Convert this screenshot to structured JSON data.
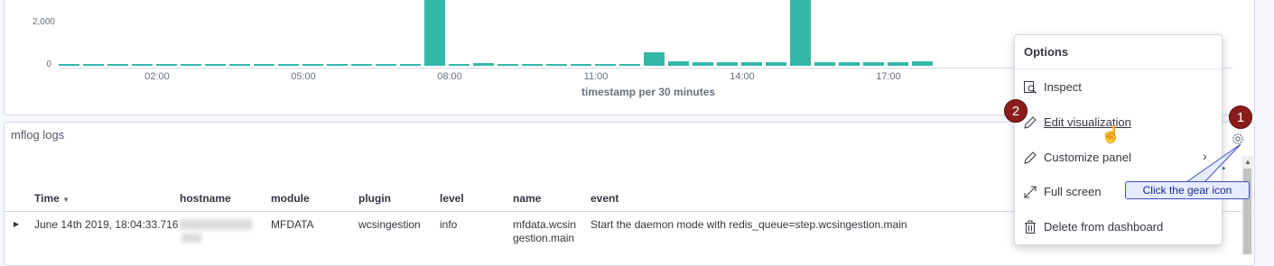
{
  "chart": {
    "y_ticks": [
      "2,000",
      "0"
    ],
    "x_ticks": [
      "02:00",
      "05:00",
      "08:00",
      "11:00",
      "14:00",
      "17:00"
    ],
    "x_title": "timestamp per 30 minutes",
    "bar_color": "#35b8a8"
  },
  "chart_data": {
    "type": "bar",
    "title": "",
    "xlabel": "timestamp per 30 minutes",
    "ylabel": "",
    "x": [
      "00:30",
      "01:00",
      "01:30",
      "02:00",
      "02:30",
      "03:00",
      "03:30",
      "04:00",
      "04:30",
      "05:00",
      "05:30",
      "06:00",
      "06:30",
      "07:00",
      "07:30",
      "08:00",
      "08:30",
      "09:00",
      "09:30",
      "10:00",
      "10:30",
      "11:00",
      "11:30",
      "12:00",
      "12:30",
      "13:00",
      "13:30",
      "14:00",
      "14:30",
      "15:00",
      "15:30",
      "16:00",
      "16:30",
      "17:00",
      "17:30",
      "18:00"
    ],
    "values": [
      100,
      100,
      100,
      100,
      100,
      100,
      100,
      100,
      100,
      100,
      100,
      100,
      100,
      100,
      100,
      3200,
      100,
      120,
      100,
      100,
      100,
      100,
      100,
      100,
      640,
      220,
      160,
      160,
      160,
      160,
      3200,
      160,
      160,
      160,
      160,
      200
    ],
    "ylim": [
      0,
      3100
    ]
  },
  "logs": {
    "title": "mflog logs",
    "columns": [
      "Time",
      "hostname",
      "module",
      "plugin",
      "level",
      "name",
      "event"
    ],
    "row": {
      "time": "June 14th 2019, 18:04:33.716",
      "module": "MFDATA",
      "plugin": "wcsingestion",
      "level": "info",
      "name_line1": "mfdata.wcsin",
      "name_line2": "gestion.main",
      "event": "Start the daemon mode with redis_queue=step.wcsingestion.main"
    }
  },
  "menu": {
    "title": "Options",
    "items": [
      {
        "label": "Inspect",
        "icon": "inspect-icon"
      },
      {
        "label": "Edit visualization",
        "icon": "pencil-icon"
      },
      {
        "label": "Customize panel",
        "icon": "pencil-icon"
      },
      {
        "label": "Full screen",
        "icon": "expand-icon"
      },
      {
        "label": "Delete from dashboard",
        "icon": "trash-icon"
      }
    ]
  },
  "annotations": {
    "badge1": "1",
    "badge2": "2",
    "callout": "Click the gear icon",
    "badge_color": "#8b1c1c"
  }
}
